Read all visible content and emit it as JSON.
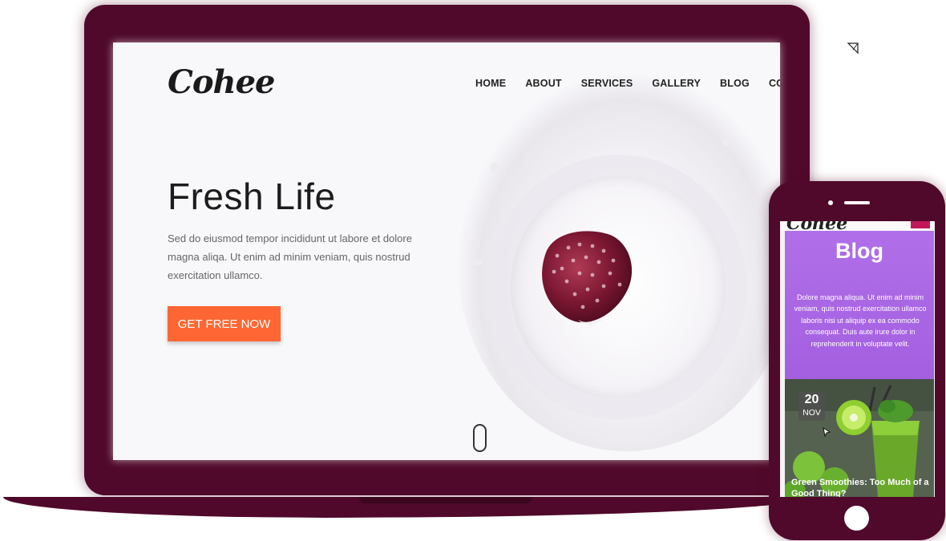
{
  "laptop": {
    "logo": "Cohee",
    "nav": [
      "HOME",
      "ABOUT",
      "SERVICES",
      "GALLERY",
      "BLOG",
      "CONTACT"
    ],
    "hero": {
      "title": "Fresh Life",
      "text": "Sed do eiusmod tempor incididunt ut labore et dolore magna aliqa. Ut enim ad minim veniam, quis nostrud exercitation ullamco.",
      "button": "GET FREE NOW",
      "button_color": "#ff6633"
    },
    "scroll_icon": "mouse-scroll-icon",
    "image": "strawberry-milk-splash"
  },
  "phone": {
    "logo": "Cohee",
    "menu_icon": "menu-icon",
    "blog": {
      "title": "Blog",
      "text": "Dolore magna aliqua. Ut enim ad minim veniam, quis nostrud exercitation ullamco laboris nisi ut aliquip ex ea commodo consequat. Duis aute irure dolor in reprehenderit in voluptate velit.",
      "background": "#a964e4"
    },
    "post": {
      "day": "20",
      "month": "NOV",
      "title": "Green Smoothies: Too Much of a Good Thing?"
    }
  },
  "colors": {
    "device": "#50092a",
    "accent": "#ff6633"
  }
}
